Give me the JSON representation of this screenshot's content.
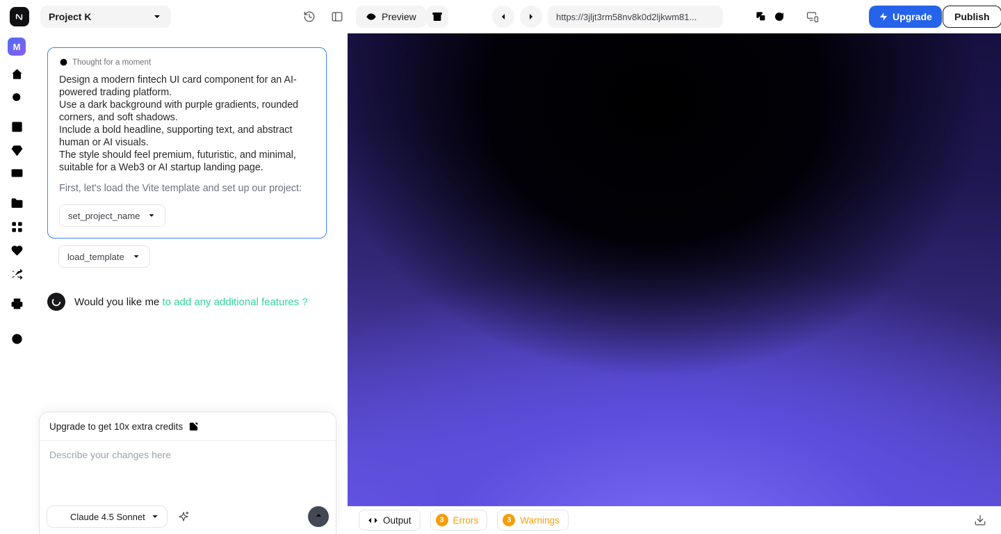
{
  "header": {
    "project_name": "Project K",
    "preview_label": "Preview",
    "url": "https://3jljt3rm58nv8k0d2ljkwm81...",
    "upgrade_label": "Upgrade",
    "publish_label": "Publish"
  },
  "sidebar": {
    "avatar_letter": "M"
  },
  "chat": {
    "thought_label": "Thought for a moment",
    "prompt": "Design a modern fintech UI card component for an AI-powered trading platform.\nUse a dark background with purple gradients, rounded corners, and soft shadows.\nInclude a bold headline, supporting text, and abstract human or AI visuals.\nThe style should feel premium, futuristic, and minimal, suitable for a Web3 or AI startup landing page.",
    "setup_text": "First, let's load the Vite template and set up our project:",
    "tool_calls": [
      "set_project_name",
      "load_template"
    ],
    "status_plain": "Would you like me",
    "status_highlight": "to add any additional features ?"
  },
  "composer": {
    "upsell_text": "Upgrade to get 10x extra credits",
    "placeholder": "Describe your changes here",
    "model_name": "Claude 4.5 Sonnet"
  },
  "output_bar": {
    "output_label": "Output",
    "errors_count": "3",
    "errors_label": "Errors",
    "warnings_count": "3",
    "warnings_label": "Warnings"
  },
  "colors": {
    "accent_blue": "#2563eb",
    "prompt_card_border": "#3b82f6",
    "status_green": "#34d399",
    "warning_orange": "#f59e0b",
    "claude_orange": "#d97757",
    "preview_purple": "#6a5ce6"
  }
}
